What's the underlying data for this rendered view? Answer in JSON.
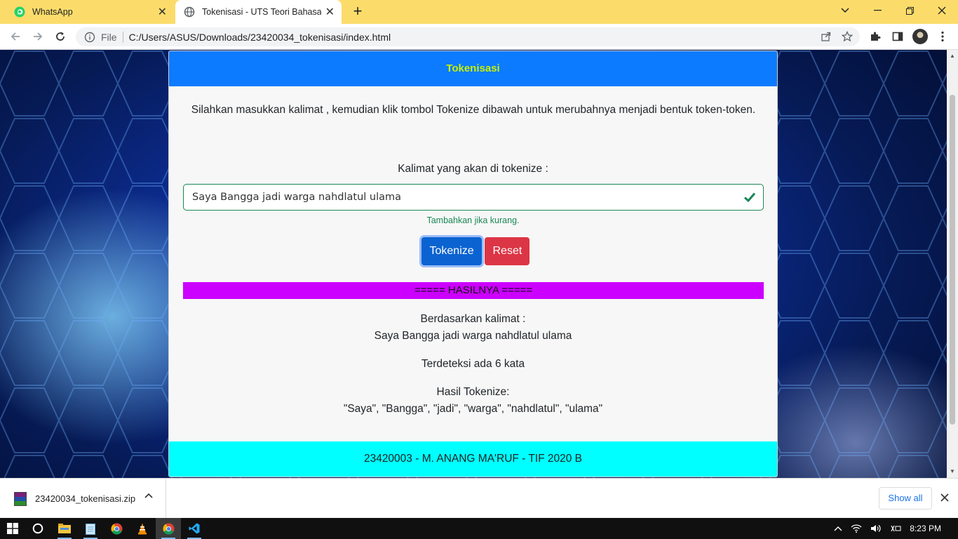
{
  "browser": {
    "tabs": [
      {
        "title": "WhatsApp",
        "icon": "whatsapp-icon"
      },
      {
        "title": "Tokenisasi - UTS Teori Bahasa dan",
        "icon": "globe-icon"
      }
    ],
    "address": {
      "scheme_label": "File",
      "url": "C:/Users/ASUS/Downloads/23420034_tokenisasi/index.html"
    }
  },
  "page": {
    "header_title": "Tokenisasi",
    "intro": "Silahkan masukkan kalimat , kemudian klik tombol Tokenize dibawah untuk merubahnya menjadi bentuk token-token.",
    "input_label": "Kalimat yang akan di tokenize :",
    "input_value": "Saya Bangga jadi warga nahdlatul ulama",
    "feedback": "Tambahkan jika kurang.",
    "tokenize_label": "Tokenize",
    "reset_label": "Reset",
    "result_banner": "===== HASILNYA =====",
    "based_on_label": "Berdasarkan kalimat :",
    "based_on_value": "Saya Bangga jadi warga nahdlatul ulama",
    "word_count_text": "Terdeteksi ada 6 kata",
    "result_label": "Hasil Tokenize:",
    "result_value": "\"Saya\", \"Bangga\", \"jadi\", \"warga\", \"nahdlatul\", \"ulama\"",
    "footer": "23420003 - M. ANANG MA'RUF - TIF 2020 B"
  },
  "downloads": {
    "file": "23420034_tokenisasi.zip",
    "show_all": "Show all"
  },
  "taskbar": {
    "clock": "8:23 PM",
    "apps": [
      "start-icon",
      "cortana-icon",
      "file-explorer-icon",
      "notepad-icon",
      "chrome-icon",
      "vlc-icon",
      "chrome-active-icon",
      "vscode-icon"
    ]
  },
  "colors": {
    "tab_strip": "#fbdc6b",
    "card_header": "#0d7bff",
    "header_text": "#c8f000",
    "result_banner": "#cc00ff",
    "footer": "#00ffff",
    "tokenize_button": "#0b63d1",
    "reset_button": "#dc3545",
    "valid_green": "#198754"
  }
}
